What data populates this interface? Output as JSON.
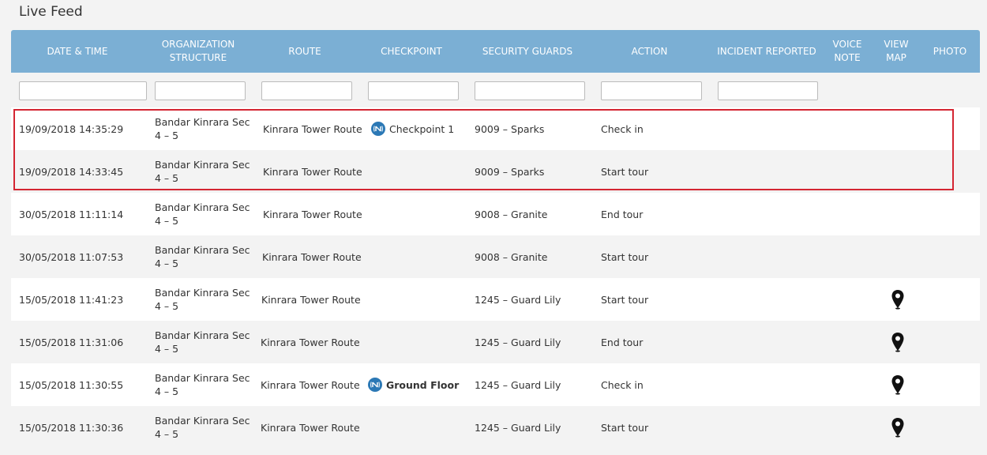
{
  "page": {
    "title": "Live Feed"
  },
  "table": {
    "headers": {
      "datetime": "DATE & TIME",
      "org1": "ORGANIZATION",
      "org2": "STRUCTURE",
      "route": "ROUTE",
      "checkpoint": "CHECKPOINT",
      "guards": "SECURITY GUARDS",
      "action": "ACTION",
      "incident": "INCIDENT REPORTED",
      "voice1": "VOICE",
      "voice2": "NOTE",
      "map1": "VIEW",
      "map2": "MAP",
      "photo": "PHOTO"
    },
    "filters": {
      "datetime": "",
      "org": "",
      "route": "",
      "checkpoint": "",
      "guards": "",
      "action": "",
      "incident": ""
    },
    "rows": [
      {
        "datetime": "19/09/2018 14:35:29",
        "org": "Bandar Kinrara Sec 4 – 5",
        "route": "Kinrara Tower Route",
        "checkpoint": "Checkpoint 1",
        "guard": "9009 – Sparks",
        "action": "Check in",
        "map": false
      },
      {
        "datetime": "19/09/2018 14:33:45",
        "org": "Bandar Kinrara Sec 4 – 5",
        "route": "Kinrara Tower Route",
        "checkpoint": "",
        "guard": "9009 – Sparks",
        "action": "Start tour",
        "map": false
      },
      {
        "datetime": "30/05/2018 11:11:14",
        "org": "Bandar Kinrara Sec 4 – 5",
        "route": "Kinrara Tower Route",
        "checkpoint": "",
        "guard": "9008 – Granite",
        "action": "End tour",
        "map": false
      },
      {
        "datetime": "30/05/2018 11:07:53",
        "org": "Bandar Kinrara Sec 4 – 5",
        "route": "Kinrara Tower Route",
        "checkpoint": "",
        "guard": "9008 – Granite",
        "action": "Start tour",
        "map": false
      },
      {
        "datetime": "15/05/2018 11:41:23",
        "org": "Bandar Kinrara Sec 4 – 5",
        "route": "Kinrara Tower Route",
        "checkpoint": "",
        "guard": "1245 – Guard Lily",
        "action": "Start tour",
        "map": true
      },
      {
        "datetime": "15/05/2018 11:31:06",
        "org": "Bandar Kinrara Sec 4 – 5",
        "route": "Kinrara Tower Route",
        "checkpoint": "",
        "guard": "1245 – Guard Lily",
        "action": "End tour",
        "map": true
      },
      {
        "datetime": "15/05/2018 11:30:55",
        "org": "Bandar Kinrara Sec 4 – 5",
        "route": "Kinrara Tower Route",
        "checkpoint": "Ground Floor",
        "guard": "1245 – Guard Lily",
        "action": "Check in",
        "map": true
      },
      {
        "datetime": "15/05/2018 11:30:36",
        "org": "Bandar Kinrara Sec 4 – 5",
        "route": "Kinrara Tower Route",
        "checkpoint": "",
        "guard": "1245 – Guard Lily",
        "action": "Start tour",
        "map": true
      }
    ]
  },
  "colors": {
    "header_bg": "#7bafd4",
    "highlight": "#d42532",
    "nfc_icon": "#2b78b5"
  },
  "icons": {
    "checkpoint": "nfc-icon",
    "map": "map-pin-icon"
  }
}
